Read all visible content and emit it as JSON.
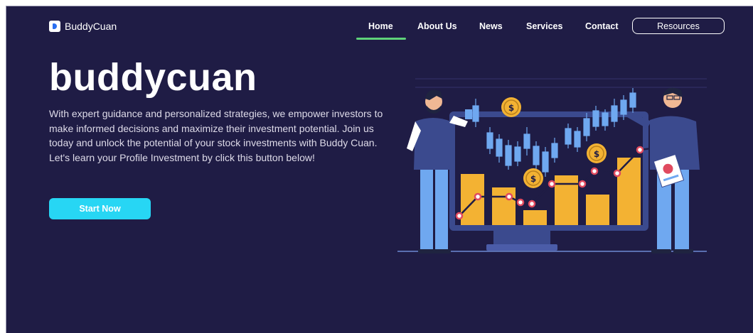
{
  "brand": {
    "name": "BuddyCuan"
  },
  "nav": {
    "items": [
      {
        "label": "Home",
        "active": true
      },
      {
        "label": "About Us"
      },
      {
        "label": "News"
      },
      {
        "label": "Services"
      },
      {
        "label": "Contact"
      }
    ],
    "cta": "Resources"
  },
  "hero": {
    "title": "buddycuan",
    "description": "With expert guidance and personalized strategies, we empower investors to make informed decisions and maximize their investment potential. Join us today and unlock the potential of your stock investments with Buddy Cuan. Let's learn your Profile Investment by click this button below!",
    "button": "Start Now"
  },
  "colors": {
    "background": "#1f1c45",
    "accent": "#27d6f4",
    "active_underline": "#5fd27a",
    "chart_bar": "#f3b233",
    "candle": "#6fa8f0",
    "monitor": "#3b4a8e"
  },
  "illustration": {
    "name": "stock-investment-illustration"
  }
}
